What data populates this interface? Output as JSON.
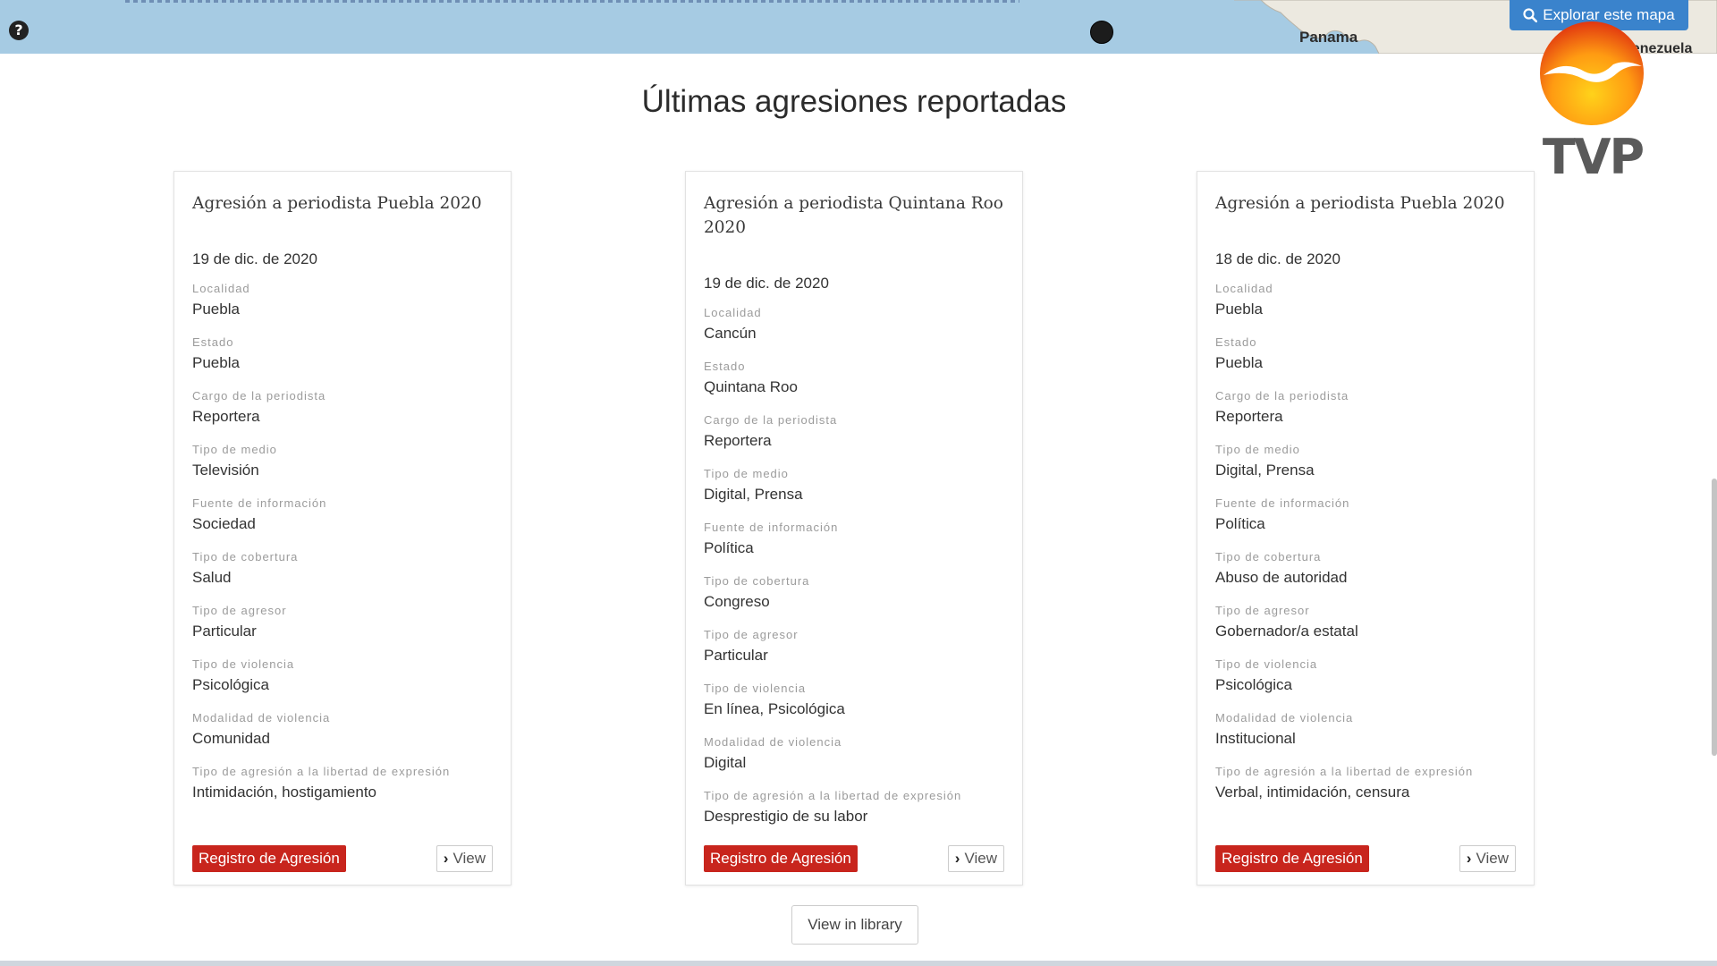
{
  "map": {
    "label_panama": "Panama",
    "label_venezuela": "Venezuela",
    "explore_button": "Explorar este mapa",
    "icons": {
      "help": "question-circle-icon",
      "search": "search-icon",
      "marker": "map-marker-icon"
    },
    "colors": {
      "sea": "#a6cbe3",
      "land": "#ece9e0",
      "button": "#3a83cc"
    }
  },
  "logo": {
    "text": "TVP"
  },
  "section": {
    "title": "Últimas agresiones reportadas"
  },
  "labels": {
    "localidad": "Localidad",
    "estado": "Estado",
    "cargo": "Cargo de la periodista",
    "medio": "Tipo de medio",
    "fuente": "Fuente de información",
    "cobertura": "Tipo de cobertura",
    "agresor": "Tipo de agresor",
    "violencia": "Tipo de violencia",
    "modalidad": "Modalidad de violencia",
    "agresion": "Tipo de agresión a la libertad de expresión"
  },
  "cards": [
    {
      "title": "Agresión a periodista Puebla 2020",
      "date": "19 de dic. de 2020",
      "localidad": "Puebla",
      "estado": "Puebla",
      "cargo": "Reportera",
      "medio": "Televisión",
      "fuente": "Sociedad",
      "cobertura": "Salud",
      "agresor": "Particular",
      "violencia": "Psicológica",
      "modalidad": "Comunidad",
      "agresion": "Intimidación, hostigamiento",
      "register_button": "Registro de Agresión",
      "view_button": "View"
    },
    {
      "title": "Agresión a periodista Quintana Roo 2020",
      "date": "19 de dic. de 2020",
      "localidad": "Cancún",
      "estado": "Quintana Roo",
      "cargo": "Reportera",
      "medio": "Digital, Prensa",
      "fuente": "Política",
      "cobertura": "Congreso",
      "agresor": "Particular",
      "violencia": "En línea, Psicológica",
      "modalidad": "Digital",
      "agresion": "Desprestigio de su labor",
      "register_button": "Registro de Agresión",
      "view_button": "View"
    },
    {
      "title": "Agresión a periodista Puebla 2020",
      "date": "18 de dic. de 2020",
      "localidad": "Puebla",
      "estado": "Puebla",
      "cargo": "Reportera",
      "medio": "Digital, Prensa",
      "fuente": "Política",
      "cobertura": "Abuso de autoridad",
      "agresor": "Gobernador/a estatal",
      "violencia": "Psicológica",
      "modalidad": "Institucional",
      "agresion": "Verbal, intimidación, censura",
      "register_button": "Registro de Agresión",
      "view_button": "View"
    }
  ],
  "library_button": "View in library",
  "colors": {
    "register_button": "#c8251d",
    "title_text": "#2b2b2b",
    "label_text": "#9b9b9b"
  }
}
